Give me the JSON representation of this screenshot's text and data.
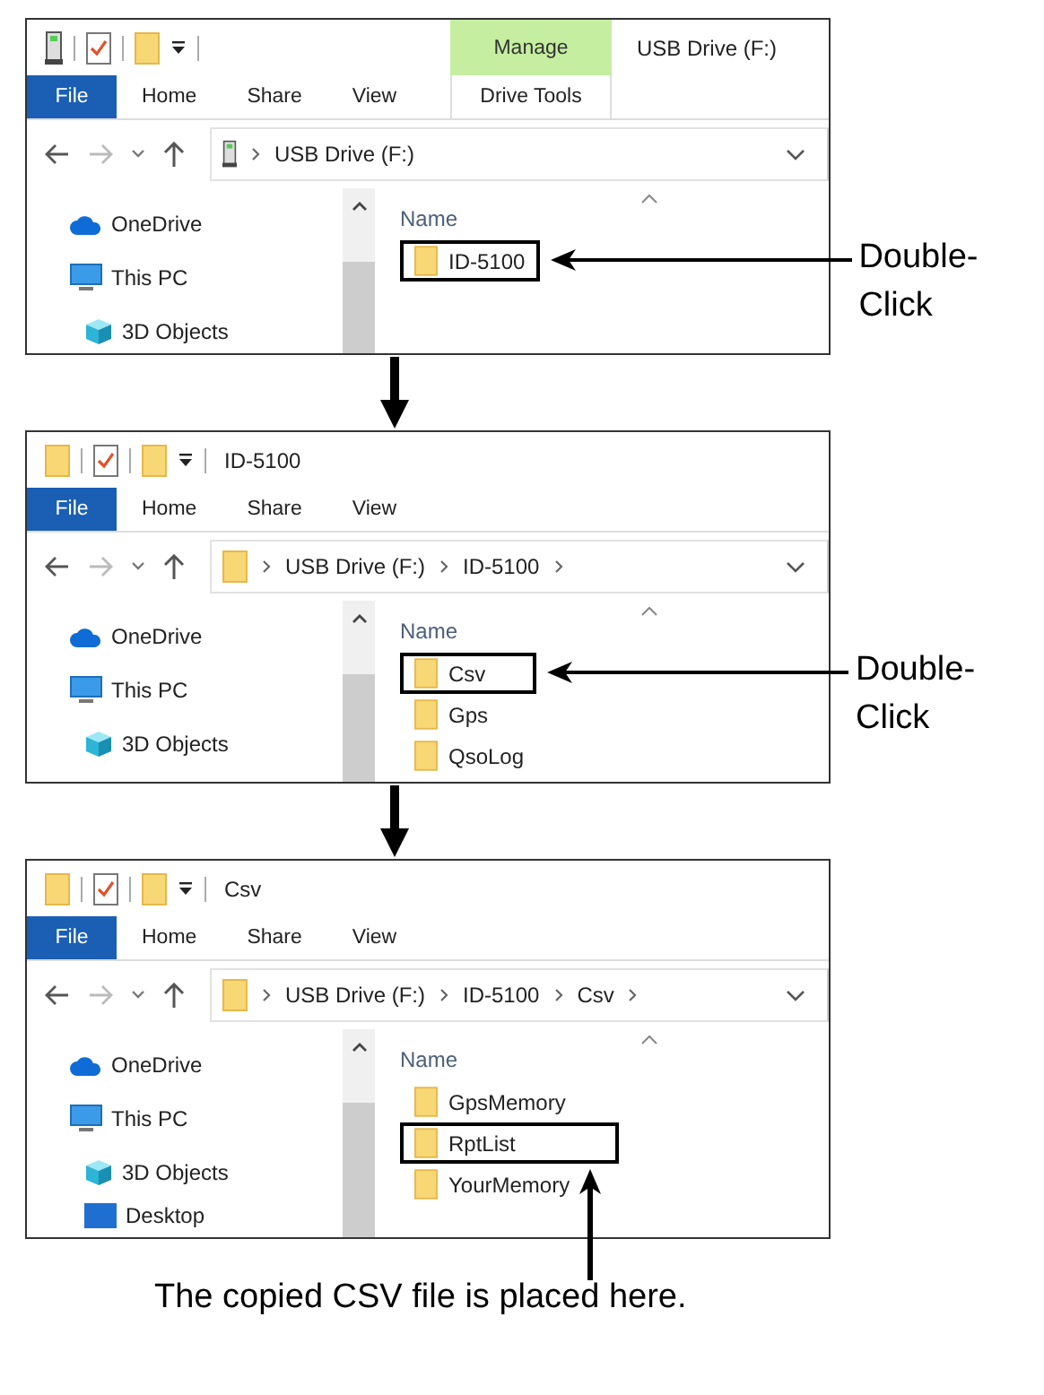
{
  "windows": [
    {
      "kind": "drive",
      "title": "USB Drive (F:)",
      "context_tab": {
        "group": "Manage",
        "label": "Drive Tools"
      },
      "ribbon_tabs": [
        {
          "label": "File",
          "selected": true
        },
        {
          "label": "Home",
          "selected": false
        },
        {
          "label": "Share",
          "selected": false
        },
        {
          "label": "View",
          "selected": false
        }
      ],
      "path": {
        "crumbs": [
          "USB Drive (F:)"
        ]
      },
      "nav": [
        {
          "label": "OneDrive",
          "kind": "cloud"
        },
        {
          "label": "This PC",
          "kind": "pc",
          "children": [
            {
              "label": "3D Objects",
              "kind": "cube"
            }
          ]
        }
      ],
      "column": "Name",
      "items": [
        {
          "name": "ID-5100",
          "highlighted": true
        }
      ],
      "callout": {
        "kind": "side",
        "text": "Double-Click"
      }
    },
    {
      "kind": "folder",
      "title": "ID-5100",
      "ribbon_tabs": [
        {
          "label": "File",
          "selected": true
        },
        {
          "label": "Home",
          "selected": false
        },
        {
          "label": "Share",
          "selected": false
        },
        {
          "label": "View",
          "selected": false
        }
      ],
      "path": {
        "crumbs": [
          "USB Drive (F:)",
          "ID-5100"
        ]
      },
      "nav": [
        {
          "label": "OneDrive",
          "kind": "cloud"
        },
        {
          "label": "This PC",
          "kind": "pc",
          "children": [
            {
              "label": "3D Objects",
              "kind": "cube"
            }
          ]
        }
      ],
      "column": "Name",
      "items": [
        {
          "name": "Csv",
          "highlighted": true
        },
        {
          "name": "Gps",
          "highlighted": false
        },
        {
          "name": "QsoLog",
          "highlighted": false
        }
      ],
      "callout": {
        "kind": "side",
        "text": "Double-Click"
      }
    },
    {
      "kind": "folder",
      "title": "Csv",
      "ribbon_tabs": [
        {
          "label": "File",
          "selected": true
        },
        {
          "label": "Home",
          "selected": false
        },
        {
          "label": "Share",
          "selected": false
        },
        {
          "label": "View",
          "selected": false
        }
      ],
      "path": {
        "crumbs": [
          "USB Drive (F:)",
          "ID-5100",
          "Csv"
        ]
      },
      "nav": [
        {
          "label": "OneDrive",
          "kind": "cloud"
        },
        {
          "label": "This PC",
          "kind": "pc",
          "children": [
            {
              "label": "3D Objects",
              "kind": "cube"
            },
            {
              "label": "Desktop",
              "kind": "desktop"
            }
          ]
        }
      ],
      "column": "Name",
      "items": [
        {
          "name": "GpsMemory",
          "highlighted": false
        },
        {
          "name": "RptList",
          "highlighted": true
        },
        {
          "name": "YourMemory",
          "highlighted": false
        }
      ],
      "callout": {
        "kind": "below",
        "text": "The copied CSV file is placed here."
      }
    }
  ]
}
